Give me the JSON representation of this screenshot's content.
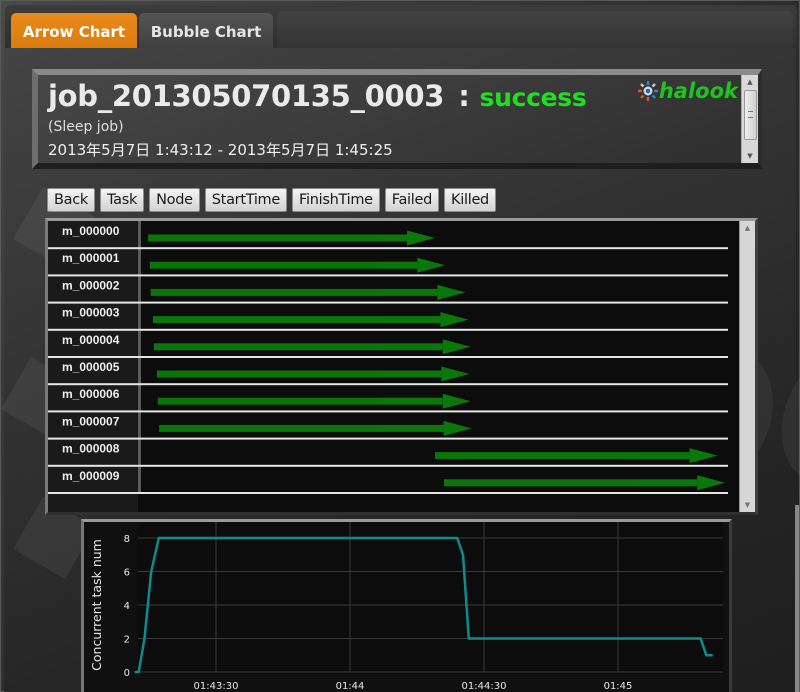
{
  "tabs": [
    {
      "label": "Arrow Chart",
      "active": true
    },
    {
      "label": "Bubble Chart",
      "active": false
    }
  ],
  "header": {
    "job_id": "job_201305070135_0003",
    "separator": ":",
    "status": "success",
    "status_color": "#1fe01f",
    "job_name": "(Sleep job)",
    "date_range": "2013年5月7日 1:43:12 - 2013年5月7日 1:45:25",
    "logo_text": "halook",
    "logo_icon": "gear-eye-icon"
  },
  "toolbar": {
    "buttons": [
      "Back",
      "Task",
      "Node",
      "StartTime",
      "FinishTime",
      "Failed",
      "Killed"
    ]
  },
  "watermark": "halook",
  "chart_data": [
    {
      "type": "bar",
      "title": "Arrow Chart",
      "arrow_color": "#0a8a0a",
      "time_range": [
        "01:43:12",
        "01:45:25"
      ],
      "tasks": [
        {
          "id": "m_000000",
          "start_s": 12.7,
          "end_s": 77.0
        },
        {
          "id": "m_000001",
          "start_s": 13.1,
          "end_s": 79.3
        },
        {
          "id": "m_000002",
          "start_s": 13.3,
          "end_s": 83.8
        },
        {
          "id": "m_000003",
          "start_s": 13.8,
          "end_s": 84.5
        },
        {
          "id": "m_000004",
          "start_s": 14.0,
          "end_s": 85.0
        },
        {
          "id": "m_000005",
          "start_s": 14.7,
          "end_s": 84.7
        },
        {
          "id": "m_000006",
          "start_s": 14.9,
          "end_s": 85.0
        },
        {
          "id": "m_000007",
          "start_s": 15.2,
          "end_s": 85.2
        },
        {
          "id": "m_000008",
          "start_s": 77.0,
          "end_s": 140.3
        },
        {
          "id": "m_000009",
          "start_s": 79.0,
          "end_s": 142.0
        }
      ]
    },
    {
      "type": "line",
      "title": "",
      "xlabel": "",
      "ylabel": "Concurrent task num",
      "line_color": "#0e8c8c",
      "x_tick_labels": [
        "01:43:30",
        "01:44",
        "01:44:30",
        "01:45"
      ],
      "x_ticks_s": [
        30,
        60,
        90,
        120
      ],
      "xlim_s": [
        12,
        143
      ],
      "ylim": [
        0,
        8.6
      ],
      "y_ticks": [
        0,
        2,
        4,
        6,
        8
      ],
      "grid": true,
      "series": [
        {
          "name": "Concurrent task num",
          "x_s": [
            12.0,
            12.7,
            14.0,
            15.5,
            17.2,
            84.0,
            85.3,
            86.6,
            138.5,
            139.8,
            141.0
          ],
          "values": [
            0,
            0,
            2,
            6,
            8,
            8,
            7,
            2,
            2,
            1,
            1
          ]
        }
      ]
    }
  ]
}
